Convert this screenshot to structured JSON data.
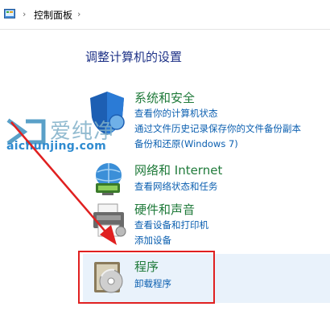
{
  "breadcrumb": {
    "icon": "control-panel-icon",
    "separator": "›",
    "current": "控制面板",
    "trailing_separator": "›"
  },
  "main": {
    "heading": "调整计算机的设置",
    "categories": [
      {
        "title": "系统和安全",
        "icon": "shield-icon",
        "links": [
          "查看你的计算机状态",
          "通过文件历史记录保存你的文件备份副本",
          "备份和还原(Windows 7)"
        ]
      },
      {
        "title": "网络和 Internet",
        "icon": "network-icon",
        "links": [
          "查看网络状态和任务"
        ]
      },
      {
        "title": "硬件和声音",
        "icon": "printer-icon",
        "links": [
          "查看设备和打印机",
          "添加设备"
        ]
      },
      {
        "title": "程序",
        "icon": "programs-disc-icon",
        "links": [
          "卸载程序"
        ]
      }
    ]
  },
  "watermark": {
    "text": "爱纯净",
    "url": "aichunjing.com"
  },
  "annotation": {
    "highlight_color": "#e02020",
    "arrow_color": "#e02020"
  }
}
